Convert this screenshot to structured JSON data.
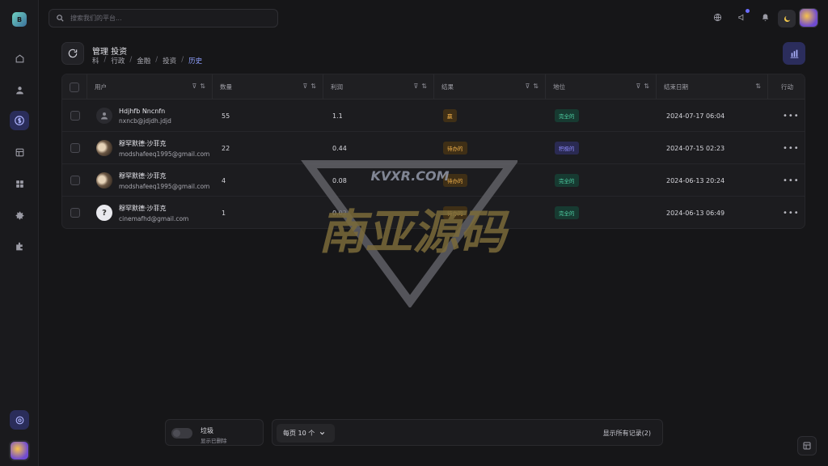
{
  "search": {
    "placeholder": "搜索我们的平台..."
  },
  "page": {
    "title": "管理 投资",
    "breadcrumb": [
      "科",
      "行政",
      "金融",
      "投资",
      "历史"
    ]
  },
  "table": {
    "columns": [
      "用户",
      "数量",
      "利润",
      "结果",
      "地位",
      "结束日期",
      "行动"
    ],
    "rows": [
      {
        "name": "Hdjhfb Nncnfn",
        "email": "nxncb@jdjdh.jdjd",
        "avatar": "default-avatar",
        "quantity": "55",
        "profit": "1.1",
        "result": "赢",
        "result_color": "#f0b04a",
        "status": "完全的",
        "status_color": "#4fd1a5",
        "end_date": "2024-07-17 06:04"
      },
      {
        "name": "穆罕默德·沙菲克",
        "email": "modshafeeq1995@gmail.com",
        "avatar": "photo-avatar",
        "quantity": "22",
        "profit": "0.44",
        "result": "待办的",
        "result_color": "#f0b04a",
        "status": "积极的",
        "status_color": "#8f8cff",
        "end_date": "2024-07-15 02:23"
      },
      {
        "name": "穆罕默德·沙菲克",
        "email": "modshafeeq1995@gmail.com",
        "avatar": "photo-avatar",
        "quantity": "4",
        "profit": "0.08",
        "result": "待办的",
        "result_color": "#f0b04a",
        "status": "完全的",
        "status_color": "#4fd1a5",
        "end_date": "2024-06-13 20:24"
      },
      {
        "name": "穆罕默德·沙菲克",
        "email": "cinemafhd@gmail.com",
        "avatar": "question-avatar",
        "quantity": "1",
        "profit": "0.02",
        "result": "待办的",
        "result_color": "#f0b04a",
        "status": "完全的",
        "status_color": "#4fd1a5",
        "end_date": "2024-06-13 06:49"
      }
    ],
    "row_action": "•••"
  },
  "footer": {
    "trash_label": "垃圾",
    "trash_sub": "显示已删除",
    "per_page": "每页 10 个",
    "total": "显示所有记录(2)"
  },
  "watermark": {
    "domain": "KVXR.COM",
    "text": "南亚源码"
  }
}
